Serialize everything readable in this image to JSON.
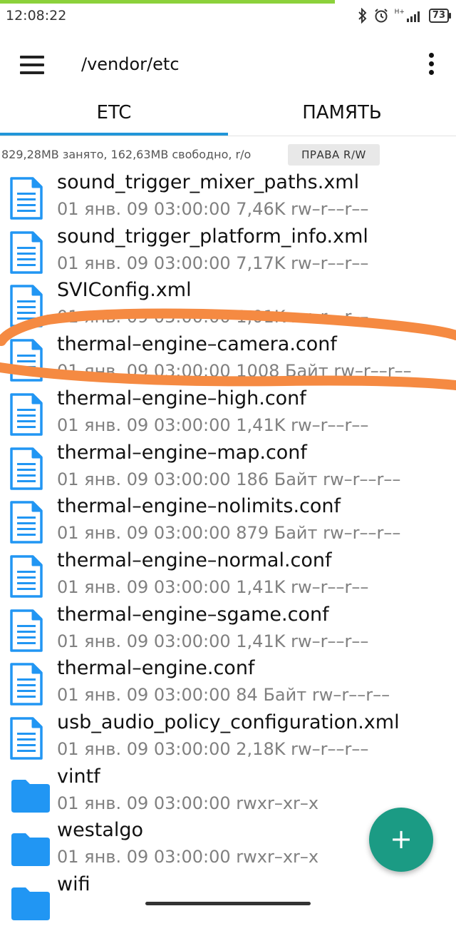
{
  "status_bar": {
    "time": "12:08:22",
    "network": "H+",
    "battery": "73",
    "icons": [
      "bluetooth-icon",
      "alarm-icon",
      "signal-icon",
      "battery-icon"
    ]
  },
  "toolbar": {
    "path": "/vendor/etc",
    "menu_icon": "menu-icon",
    "overflow_icon": "more-vert-icon"
  },
  "tabs": [
    {
      "label": "ETC",
      "active": true
    },
    {
      "label": "ПАМЯТЬ",
      "active": false
    }
  ],
  "info": {
    "storage": "829,28МВ занято, 162,63МВ свободно, r/o",
    "rw_button": "ПРАВА R/W"
  },
  "files": [
    {
      "name": "sound_trigger_mixer_paths.xml",
      "meta": "01 янв. 09 03:00:00 7,46K rw–r––r––",
      "type": "file"
    },
    {
      "name": "sound_trigger_platform_info.xml",
      "meta": "01 янв. 09 03:00:00 7,17K rw–r––r––",
      "type": "file"
    },
    {
      "name": "SVIConfig.xml",
      "meta": "01 янв. 09 03:00:00 1,01K rw–r––r––",
      "type": "file"
    },
    {
      "name": "thermal–engine–camera.conf",
      "meta": "01 янв. 09 03:00:00 1008 Байт rw–r––r––",
      "type": "file"
    },
    {
      "name": "thermal–engine–high.conf",
      "meta": "01 янв. 09 03:00:00 1,41K rw–r––r––",
      "type": "file"
    },
    {
      "name": "thermal–engine–map.conf",
      "meta": "01 янв. 09 03:00:00 186 Байт rw–r––r––",
      "type": "file"
    },
    {
      "name": "thermal–engine–nolimits.conf",
      "meta": "01 янв. 09 03:00:00 879 Байт rw–r––r––",
      "type": "file"
    },
    {
      "name": "thermal–engine–normal.conf",
      "meta": "01 янв. 09 03:00:00 1,41K rw–r––r––",
      "type": "file"
    },
    {
      "name": "thermal–engine–sgame.conf",
      "meta": "01 янв. 09 03:00:00 1,41K rw–r––r––",
      "type": "file"
    },
    {
      "name": "thermal–engine.conf",
      "meta": "01 янв. 09 03:00:00 84 Байт rw–r––r––",
      "type": "file"
    },
    {
      "name": "usb_audio_policy_configuration.xml",
      "meta": "01 янв. 09 03:00:00 2,18K rw–r––r––",
      "type": "file"
    },
    {
      "name": "vintf",
      "meta": "01 янв. 09 03:00:00   rwxr–xr–x",
      "type": "folder"
    },
    {
      "name": "westalgo",
      "meta": "01 янв. 09 03:00:00   rwxr–xr–x",
      "type": "folder"
    },
    {
      "name": "wifi",
      "meta": "",
      "type": "folder"
    }
  ],
  "fab": {
    "label": "+"
  },
  "colors": {
    "accent": "#2196d9",
    "file_icon": "#2196f3",
    "fab": "#1b9b84",
    "annotation": "#f58a42",
    "top_strip": "#8cd13b"
  }
}
